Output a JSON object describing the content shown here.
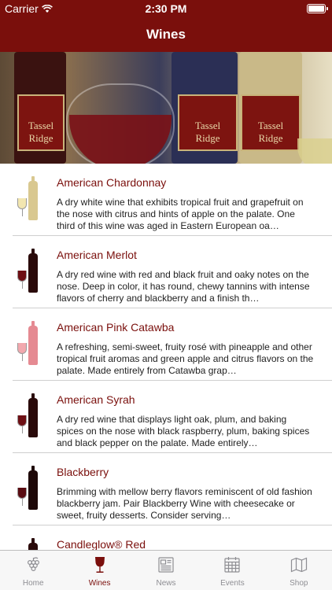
{
  "status_bar": {
    "carrier": "Carrier",
    "time": "2:30 PM"
  },
  "nav": {
    "title": "Wines"
  },
  "hero": {
    "label_text": "Tassel Ridge"
  },
  "wines": [
    {
      "name": "American Chardonnay",
      "description": "A dry white wine that exhibits tropical fruit and grapefruit on the nose with citrus and hints of apple on the palate. One third of this wine was aged in Eastern European oa…",
      "bottle_color": "#d9c890",
      "glass_fill": "#f2e6b0"
    },
    {
      "name": "American Merlot",
      "description": "A dry red wine with red and black fruit and oaky notes on the nose. Deep in color, it has round, chewy tannins with intense flavors of cherry and blackberry and a finish th…",
      "bottle_color": "#2a0a0a",
      "glass_fill": "#6e0f14"
    },
    {
      "name": "American Pink Catawba",
      "description": "A refreshing, semi-sweet, fruity rosé with pineapple and other tropical fruit aromas and green apple and citrus flavors on the palate. Made entirely from Catawba grap…",
      "bottle_color": "#e58a92",
      "glass_fill": "#f2a8ae"
    },
    {
      "name": "American Syrah",
      "description": "A dry red wine that displays light oak, plum, and baking spices on the nose with black raspberry, plum, baking spices and black pepper on the palate. Made entirely…",
      "bottle_color": "#2a0a0a",
      "glass_fill": "#6e0f14"
    },
    {
      "name": "Blackberry",
      "description": "Brimming with mellow berry flavors reminiscent of old fashion blackberry jam. Pair Blackberry Wine with cheesecake or sweet, fruity desserts. Consider serving…",
      "bottle_color": "#1e0808",
      "glass_fill": "#5a0c12"
    },
    {
      "name": "Candleglow® Red",
      "description": "",
      "bottle_color": "#2a0a0a",
      "glass_fill": "#6e0f14"
    }
  ],
  "tabs": [
    {
      "label": "Home",
      "icon": "grapes-icon",
      "active": false
    },
    {
      "label": "Wines",
      "icon": "wine-glass-icon",
      "active": true
    },
    {
      "label": "News",
      "icon": "newspaper-icon",
      "active": false
    },
    {
      "label": "Events",
      "icon": "calendar-icon",
      "active": false
    },
    {
      "label": "Shop",
      "icon": "map-icon",
      "active": false
    }
  ],
  "colors": {
    "brand": "#7a0f0c",
    "tab_inactive": "#8e8e93"
  }
}
